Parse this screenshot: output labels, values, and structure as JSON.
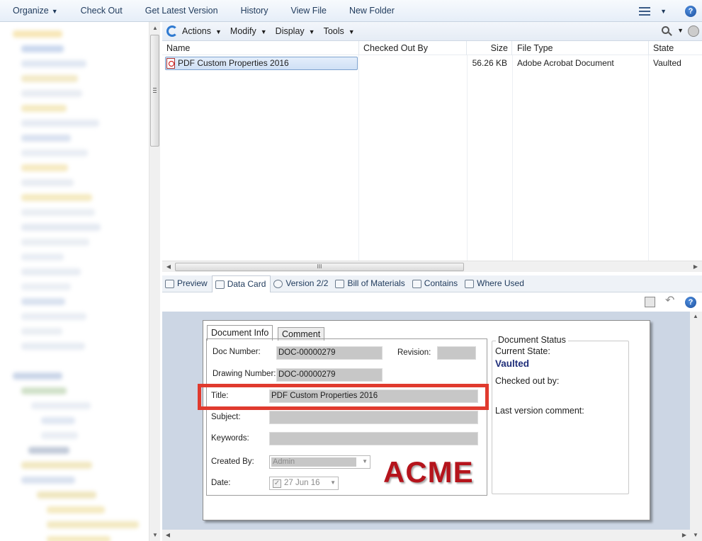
{
  "command_bar": {
    "organize": "Organize",
    "check_out": "Check Out",
    "get_latest": "Get Latest Version",
    "history": "History",
    "view_file": "View File",
    "new_folder": "New Folder",
    "help_glyph": "?"
  },
  "list_toolbar": {
    "actions": "Actions",
    "modify": "Modify",
    "display": "Display",
    "tools": "Tools"
  },
  "file_list": {
    "columns": [
      "Name",
      "Checked Out By",
      "Size",
      "File Type",
      "State"
    ],
    "rows": [
      {
        "name": "PDF Custom Properties 2016",
        "checked_out_by": "",
        "size": "56.26 KB",
        "file_type": "Adobe Acrobat Document",
        "state": "Vaulted"
      }
    ]
  },
  "tabs": [
    "Preview",
    "Data Card",
    "Version 2/2",
    "Bill of Materials",
    "Contains",
    "Where Used"
  ],
  "active_tab": "Data Card",
  "data_card": {
    "tabs": [
      "Document Info",
      "Comment"
    ],
    "doc_number_label": "Doc Number:",
    "doc_number": "DOC-00000279",
    "revision_label": "Revision:",
    "revision": "",
    "drawing_number_label": "Drawing Number:",
    "drawing_number": "DOC-00000279",
    "title_label": "Title:",
    "title": "PDF Custom Properties 2016",
    "subject_label": "Subject:",
    "subject": "",
    "keywords_label": "Keywords:",
    "keywords": "",
    "created_by_label": "Created By:",
    "created_by": "Admin",
    "date_label": "Date:",
    "date": "27 Jun  16",
    "logo_text": "ACME",
    "status": {
      "group_title": "Document Status",
      "current_state_label": "Current State:",
      "current_state": "Vaulted",
      "checked_out_by_label": "Checked out by:",
      "last_version_comment_label": "Last version comment:"
    }
  },
  "colors": {
    "highlight": "#e03a2e",
    "state_text": "#1f2e7a",
    "logo": "#b5141c",
    "card_background": "#ccd6e4"
  }
}
